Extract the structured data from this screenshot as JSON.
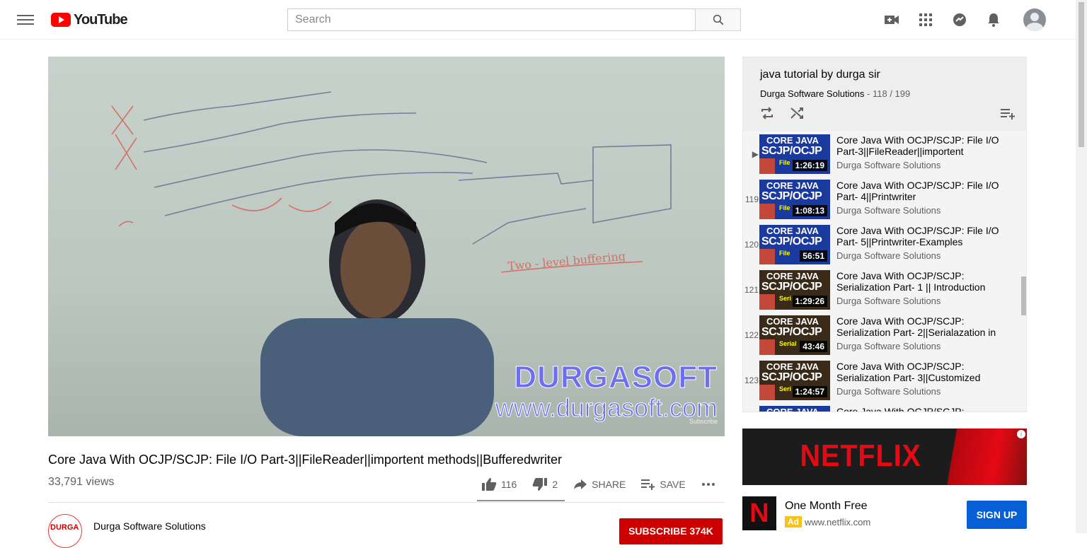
{
  "header": {
    "logo_text": "YouTube",
    "search_placeholder": "Search",
    "icons": [
      "menu-icon",
      "video-camera-icon",
      "apps-grid-icon",
      "messages-icon",
      "notifications-bell-icon",
      "account-avatar"
    ]
  },
  "player": {
    "watermark_line1": "DURGASOFT",
    "watermark_line2": "www.durgasoft.com",
    "subscribe_overlay": "Subscribe"
  },
  "video": {
    "title": "Core Java With OCJP/SCJP: File I/O Part-3||FileReader||importent methods||Bufferedwriter",
    "views": "33,791 views",
    "likes": "116",
    "dislikes": "2",
    "share_label": "SHARE",
    "save_label": "SAVE"
  },
  "channel": {
    "logo_text": "DURGA",
    "name": "Durga Software Solutions",
    "subscribe_label": "SUBSCRIBE 374K"
  },
  "playlist": {
    "title": "java tutorial by durga sir",
    "owner": "Durga Software Solutions",
    "position": "118 / 199",
    "items": [
      {
        "index": "▶",
        "title": "Core Java With OCJP/SCJP: File I/O Part-3||FileReader||importent",
        "channel": "Durga Software Solutions",
        "duration": "1:26:19",
        "thumb_l1": "CORE JAVA",
        "thumb_l2": "SCJP/OCJP",
        "thumb_tag": "File"
      },
      {
        "index": "119",
        "title": "Core Java With OCJP/SCJP: File I/O Part- 4||Printwriter",
        "channel": "Durga Software Solutions",
        "duration": "1:08:13",
        "thumb_l1": "CORE JAVA",
        "thumb_l2": "SCJP/OCJP",
        "thumb_tag": "File"
      },
      {
        "index": "120",
        "title": "Core Java With OCJP/SCJP: File I/O Part- 5||Printwriter-Examples",
        "channel": "Durga Software Solutions",
        "duration": "56:51",
        "thumb_l1": "CORE JAVA",
        "thumb_l2": "SCJP/OCJP",
        "thumb_tag": "File"
      },
      {
        "index": "121",
        "title": "Core Java With OCJP/SCJP: Serialization Part- 1 || Introduction",
        "channel": "Durga Software Solutions",
        "duration": "1:29:26",
        "thumb_l1": "CORE JAVA",
        "thumb_l2": "SCJP/OCJP",
        "thumb_tag": "Seri"
      },
      {
        "index": "122",
        "title": "Core Java With OCJP/SCJP: Serialization Part- 2||Serialazation in",
        "channel": "Durga Software Solutions",
        "duration": "43:46",
        "thumb_l1": "CORE JAVA",
        "thumb_l2": "SCJP/OCJP",
        "thumb_tag": "Serial"
      },
      {
        "index": "123",
        "title": "Core Java With OCJP/SCJP: Serialization Part- 3||Customized",
        "channel": "Durga Software Solutions",
        "duration": "1:24:57",
        "thumb_l1": "CORE JAVA",
        "thumb_l2": "SCJP/OCJP",
        "thumb_tag": "Seri"
      },
      {
        "index": "",
        "title": "Core Java With OCJP/SCJP:",
        "channel": "",
        "duration": "",
        "thumb_l1": "CORE JAVA",
        "thumb_l2": "",
        "thumb_tag": ""
      }
    ]
  },
  "ad": {
    "banner_text": "NETFLIX",
    "logo_letter": "N",
    "title": "One Month Free",
    "badge": "Ad",
    "url": "www.netflix.com",
    "cta": "SIGN UP",
    "info": "i"
  }
}
